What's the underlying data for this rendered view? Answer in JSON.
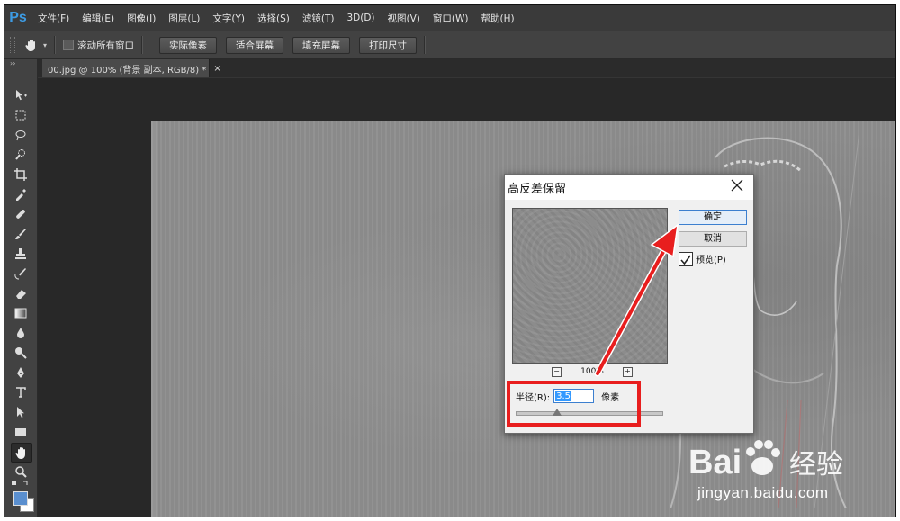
{
  "app": {
    "logo": "Ps"
  },
  "menu": [
    "文件(F)",
    "编辑(E)",
    "图像(I)",
    "图层(L)",
    "文字(Y)",
    "选择(S)",
    "滤镜(T)",
    "3D(D)",
    "视图(V)",
    "窗口(W)",
    "帮助(H)"
  ],
  "options": {
    "scroll_all_windows": "滚动所有窗口",
    "actual_pixels": "实际像素",
    "fit_screen": "适合屏幕",
    "fill_screen": "填充屏幕",
    "print_size": "打印尺寸"
  },
  "document_tab": {
    "title": "00.jpg @ 100% (背景 副本, RGB/8) *",
    "close": "×"
  },
  "toolbar": {
    "collapse": "››"
  },
  "colors": {
    "foreground": "#5a8fcf",
    "background": "#ffffff",
    "annotation": "#e81e1e"
  },
  "dialog": {
    "title": "高反差保留",
    "ok": "确定",
    "cancel": "取消",
    "preview_label": "预览(P)",
    "preview_checked": true,
    "zoom_out": "−",
    "zoom_in": "+",
    "zoom_level": "100%",
    "radius_label": "半径(R):",
    "radius_value": "3.5",
    "radius_unit": "像素"
  },
  "watermark": {
    "brand": "Bai",
    "brand_cn": "经验",
    "url": "jingyan.baidu.com"
  }
}
